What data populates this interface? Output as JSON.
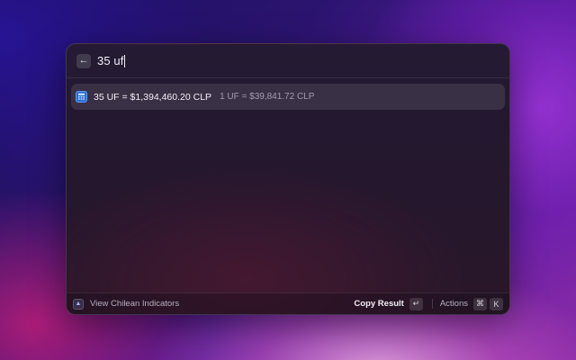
{
  "search": {
    "back_icon": "arrow-left-icon",
    "query": "35 uf"
  },
  "results": [
    {
      "icon": "calculator-icon",
      "title": "35 UF = $1,394,460.20 CLP",
      "subtitle": "1 UF = $39,841.72 CLP"
    }
  ],
  "footer": {
    "extension_icon": "extension-icon",
    "title": "View Chilean Indicators",
    "primary_action": "Copy Result",
    "primary_shortcut": "↵",
    "actions_label": "Actions",
    "actions_shortcut": [
      "⌘",
      "K"
    ]
  },
  "colors": {
    "accent": "#2a6fd6",
    "window_bg": "#241a33"
  }
}
